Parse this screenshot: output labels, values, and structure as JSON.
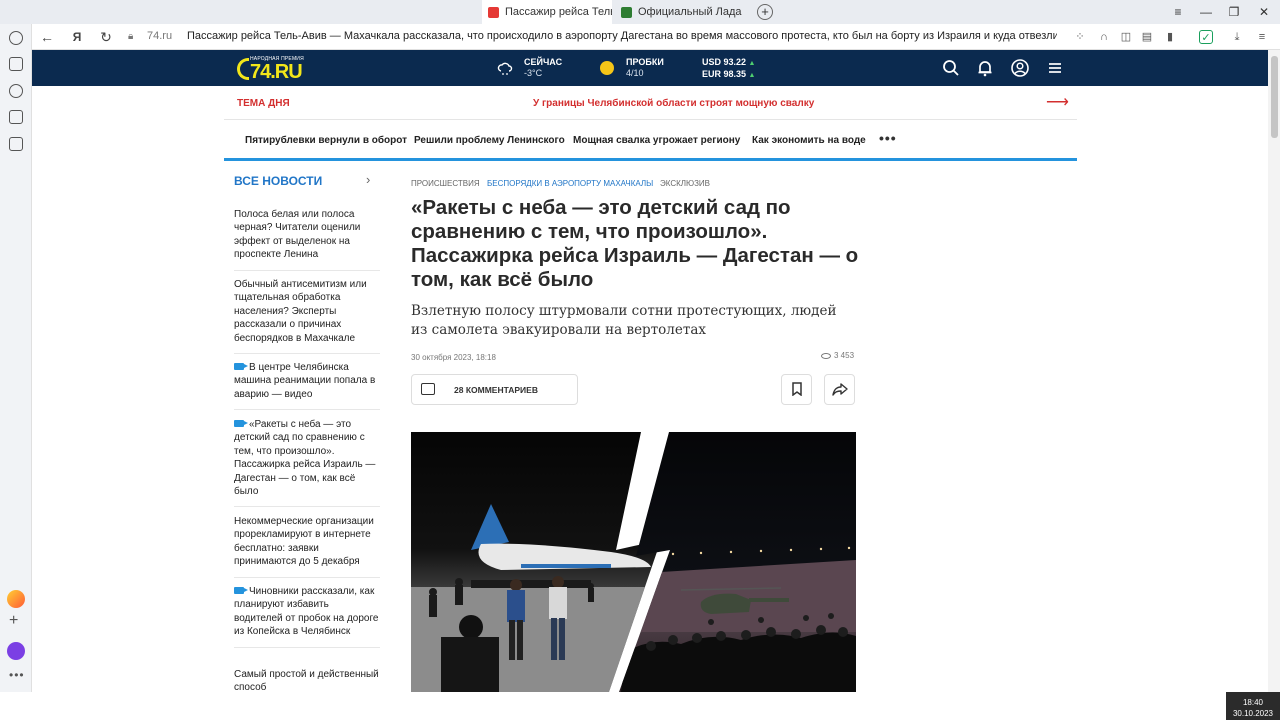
{
  "browser": {
    "tabs": [
      {
        "label": "Пассажир рейса Тель-А",
        "active": true
      },
      {
        "label": "Официальный Лада Грант",
        "active": false
      }
    ],
    "domain": "74.ru",
    "page_title": "Пассажир рейса Тель-Авив — Махачкала рассказала, что происходило в аэропорту Дагестана во время массового протеста, кто был на борту из Израиля и куда отвезли пас…"
  },
  "header": {
    "logo_caption": "НАРОДНАЯ ПРЕМИЯ",
    "logo_text": "74.RU",
    "weather": {
      "label": "СЕЙЧАС",
      "value": "-3°C"
    },
    "traffic": {
      "label": "ПРОБКИ",
      "value": "4/10"
    },
    "currency": {
      "usd": "USD 93.22",
      "eur": "EUR 98.35"
    }
  },
  "theme_day": {
    "label": "ТЕМА ДНЯ",
    "text": "У границы Челябинской области строят мощную свалку"
  },
  "nav": [
    "Пятирублевки вернули в оборот",
    "Решили проблему Ленинского",
    "Мощная свалка угрожает региону",
    "Как экономить на воде"
  ],
  "sidebar": {
    "heading": "ВСЕ НОВОСТИ",
    "items": [
      {
        "text": "Полоса белая или полоса черная? Читатели оценили эффект от выделенок на проспекте Ленина",
        "video": false
      },
      {
        "text": "Обычный антисемитизм или тщательная обработка населения? Эксперты рассказали о причинах беспорядков в Махачкале",
        "video": false
      },
      {
        "text": "В центре Челябинска машина реанимации попала в аварию — видео",
        "video": true
      },
      {
        "text": "«Ракеты с неба — это детский сад по сравнению с тем, что произошло». Пассажирка рейса Израиль — Дагестан — о том, как всё было",
        "video": true
      },
      {
        "text": "Некоммерческие организации прорекламируют в интернете бесплатно: заявки принимаются до 5 декабря",
        "video": false
      },
      {
        "text": "Чиновники рассказали, как планируют избавить водителей от пробок на дороге из Копейска в Челябинск",
        "video": true
      },
      {
        "text": "Самый простой и действенный способ",
        "video": false
      }
    ]
  },
  "article": {
    "rubrics": [
      "ПРОИСШЕСТВИЯ",
      "БЕСПОРЯДКИ В АЭРОПОРТУ МАХАЧКАЛЫ",
      "ЭКСКЛЮЗИВ"
    ],
    "title": "«Ракеты с неба — это детский сад по сравнению с тем, что произошло». Пассажирка рейса Израиль — Дагестан — о том, как всё было",
    "lede": "Взлетную полосу штурмовали сотни протестующих, людей из самолета эвакуировали на вертолетах",
    "date": "30 октября 2023, 18:18",
    "views": "3 453",
    "comments_label": "28 КОММЕНТАРИЕВ"
  },
  "system": {
    "time": "18:40",
    "date": "30.10.2023"
  },
  "colors": {
    "header_bg": "#0b2a4f",
    "logo": "#f2e61a",
    "accent_red": "#d32f2f",
    "accent_blue": "#2493dd",
    "link_blue": "#2176c7"
  }
}
